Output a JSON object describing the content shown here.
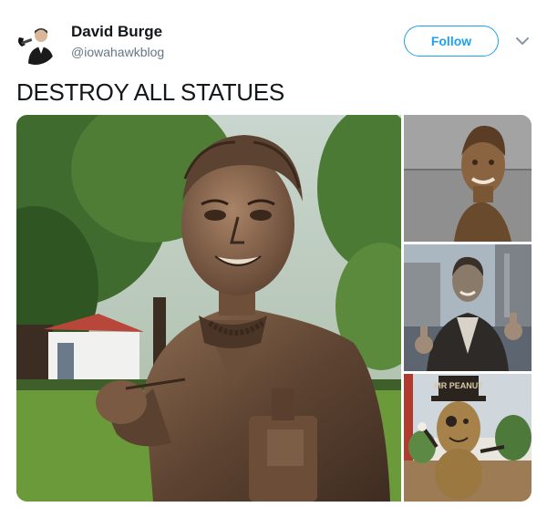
{
  "tweet": {
    "author": {
      "name": "David Burge",
      "handle": "@iowahawkblog",
      "avatar_icon": "avatar-icon"
    },
    "follow_label": "Follow",
    "menu_icon": "chevron-down-icon",
    "text": "DESTROY ALL STATUES",
    "media": {
      "main_image": "statue-lady-photo",
      "side_images": [
        "bust-photo",
        "leather-jacket-statue-photo",
        "peanut-mascot-statue-photo"
      ],
      "sign_text": "MR PEANUT"
    }
  },
  "colors": {
    "accent": "#1da1f2",
    "name": "#14171a",
    "handle": "#657786"
  }
}
